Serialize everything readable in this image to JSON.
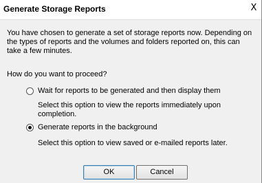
{
  "window": {
    "title": "Generate Storage Reports",
    "close_glyph": "X"
  },
  "body": {
    "intro": "You have chosen to generate a set of storage reports now. Depending on the types of reports and the volumes and folders reported on, this can take a few minutes.",
    "question": "How do you want to proceed?"
  },
  "options": [
    {
      "label": "Wait for reports to be generated and then display them",
      "description": "Select this option to view the reports immediately upon completion.",
      "selected": false
    },
    {
      "label": "Generate reports in the background",
      "description": "Select this option to view saved or e-mailed reports later.",
      "selected": true
    }
  ],
  "buttons": {
    "ok": "OK",
    "cancel": "Cancel"
  }
}
